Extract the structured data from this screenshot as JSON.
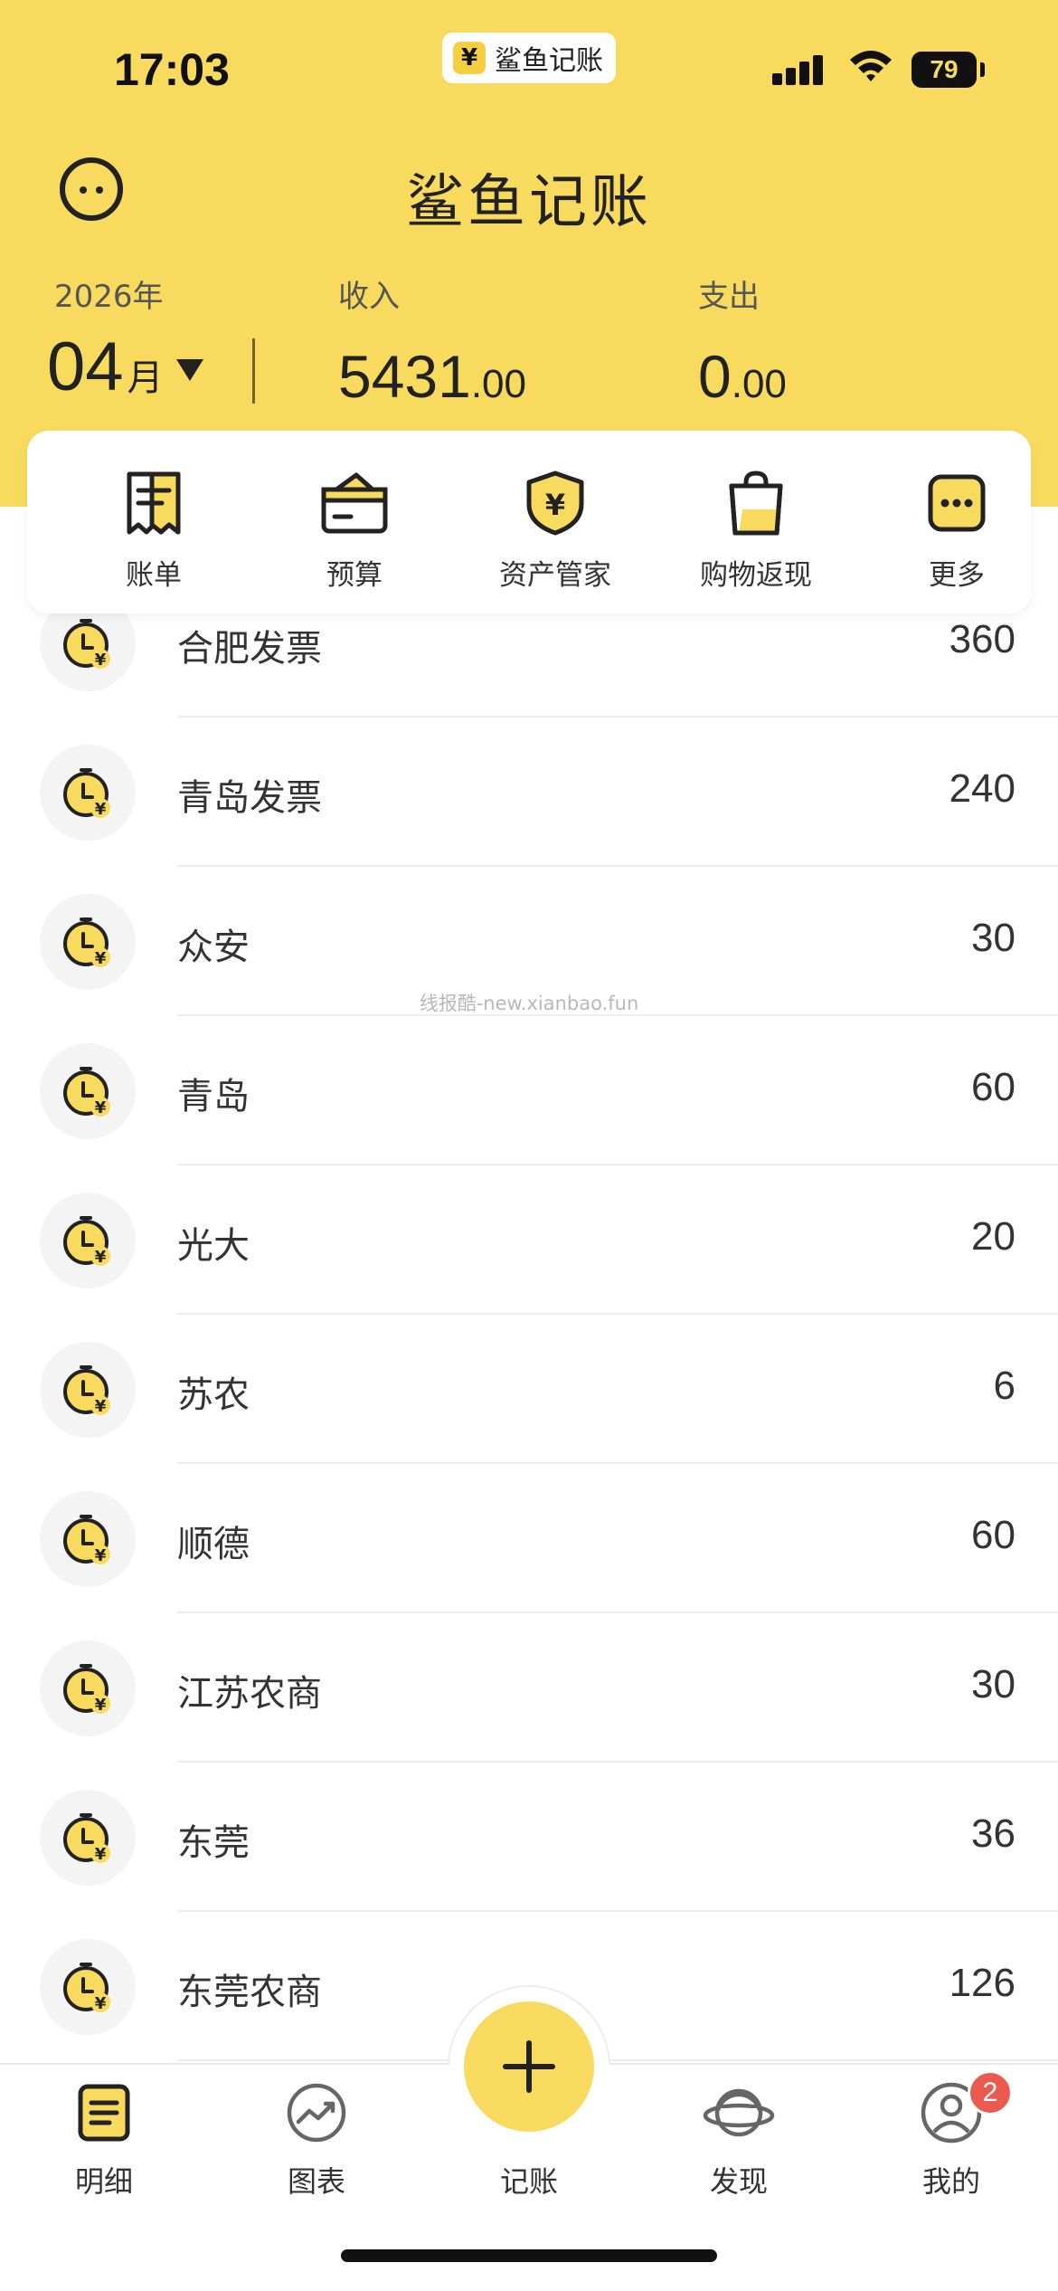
{
  "status_bar": {
    "time": "17:03",
    "app_pill": "鲨鱼记账",
    "app_pill_icon": "yen-coin-icon",
    "battery": "79"
  },
  "header": {
    "title": "鲨鱼记账",
    "year": "2026年",
    "month": "04",
    "month_unit": "月",
    "income_label": "收入",
    "income_int": "5431",
    "income_dec": ".00",
    "expense_label": "支出",
    "expense_int": "0",
    "expense_dec": ".00",
    "brand_color": "#f8db5e"
  },
  "quick_menu": [
    {
      "label": "账单",
      "icon": "bill-icon"
    },
    {
      "label": "预算",
      "icon": "wallet-icon"
    },
    {
      "label": "资产管家",
      "icon": "shield-yen-icon"
    },
    {
      "label": "购物返现",
      "icon": "shopping-bag-icon"
    },
    {
      "label": "更多",
      "icon": "more-icon"
    }
  ],
  "transactions": [
    {
      "name": "合肥发票",
      "amount": "360",
      "icon": "clock-yen-icon"
    },
    {
      "name": "青岛发票",
      "amount": "240",
      "icon": "clock-yen-icon"
    },
    {
      "name": "众安",
      "amount": "30",
      "icon": "clock-yen-icon"
    },
    {
      "name": "青岛",
      "amount": "60",
      "icon": "clock-yen-icon"
    },
    {
      "name": "光大",
      "amount": "20",
      "icon": "clock-yen-icon"
    },
    {
      "name": "苏农",
      "amount": "6",
      "icon": "clock-yen-icon"
    },
    {
      "name": "顺德",
      "amount": "60",
      "icon": "clock-yen-icon"
    },
    {
      "name": "江苏农商",
      "amount": "30",
      "icon": "clock-yen-icon"
    },
    {
      "name": "东莞",
      "amount": "36",
      "icon": "clock-yen-icon"
    },
    {
      "name": "东莞农商",
      "amount": "126",
      "icon": "clock-yen-icon"
    }
  ],
  "watermark": "线报酷-new.xianbao.fun",
  "tabbar": {
    "tabs": [
      {
        "label": "明细",
        "icon": "list-detail-icon"
      },
      {
        "label": "图表",
        "icon": "chart-icon"
      },
      {
        "label": "记账",
        "icon": "plus-icon"
      },
      {
        "label": "发现",
        "icon": "planet-icon"
      },
      {
        "label": "我的",
        "icon": "profile-icon"
      }
    ],
    "badge": "2"
  }
}
